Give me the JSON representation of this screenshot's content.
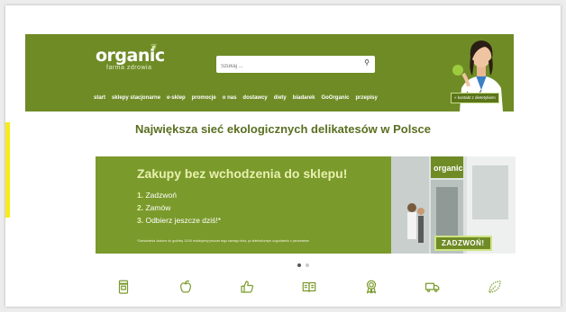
{
  "header": {
    "logo_word": "organic",
    "logo_sub": "farma zdrowia",
    "search_placeholder": "Szukaj ...",
    "cta": "« kontakt z dietetykiem"
  },
  "nav": [
    "start",
    "sklepy stacjonarne",
    "e-sklep",
    "promocje",
    "o nas",
    "dostawcy",
    "diety",
    "biadarek",
    "GoOrganic",
    "przepisy"
  ],
  "tagline": "Największa sieć ekologicznych delikatesów w Polsce",
  "banner": {
    "title": "Zakupy bez wchodzenia do sklepu!",
    "steps": [
      {
        "num": "1.",
        "text": "Zadzwoń"
      },
      {
        "num": "2.",
        "text": "Zamów"
      },
      {
        "num": "3.",
        "text": "Odbierz jeszcze dziś!*"
      }
    ],
    "note": "*Zamówienia złożone do godziny 13:00 realizujemy jeszcze tego samego dnia, po telefonicznym uzgodnieniu z personelem",
    "call_button": "ZADZWOŃ!"
  },
  "carousel": {
    "count": 2,
    "active": 0
  },
  "colors": {
    "brand_green": "#6f8b26",
    "banner_green": "#7a9a2b",
    "title_yellow": "#e9f0b0"
  },
  "icons": [
    "jar-icon",
    "apple-icon",
    "thumbs-up-icon",
    "book-icon",
    "award-icon",
    "delivery-truck-icon",
    "leaf-icon"
  ]
}
